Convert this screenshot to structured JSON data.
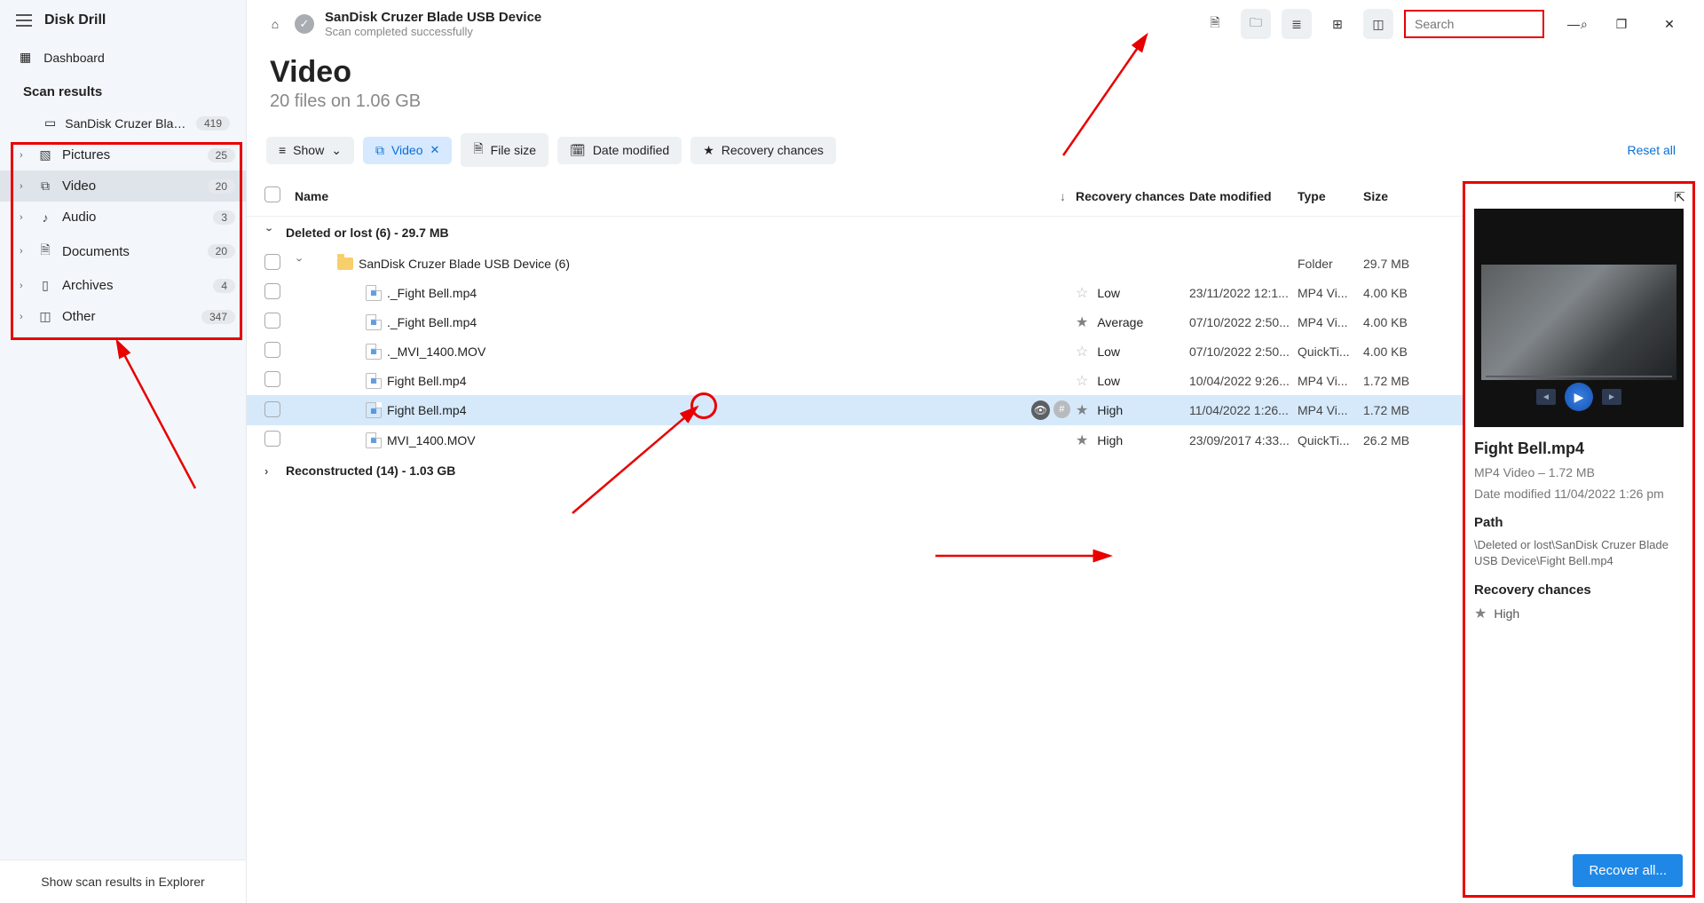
{
  "app": {
    "title": "Disk Drill"
  },
  "sidebar": {
    "dashboard": "Dashboard",
    "section": "Scan results",
    "device": {
      "label": "SanDisk Cruzer Blade US...",
      "count": "419"
    },
    "categories": [
      {
        "label": "Pictures",
        "count": "25"
      },
      {
        "label": "Video",
        "count": "20"
      },
      {
        "label": "Audio",
        "count": "3"
      },
      {
        "label": "Documents",
        "count": "20"
      },
      {
        "label": "Archives",
        "count": "4"
      },
      {
        "label": "Other",
        "count": "347"
      }
    ],
    "footer": "Show scan results in Explorer"
  },
  "header": {
    "device_title": "SanDisk Cruzer Blade USB Device",
    "status": "Scan completed successfully",
    "search_placeholder": "Search"
  },
  "heading": {
    "title": "Video",
    "subtitle": "20 files on 1.06 GB"
  },
  "chips": {
    "show": "Show",
    "video": "Video",
    "filesize": "File size",
    "datemod": "Date modified",
    "recchances": "Recovery chances",
    "reset": "Reset all"
  },
  "columns": {
    "name": "Name",
    "rec": "Recovery chances",
    "date": "Date modified",
    "type": "Type",
    "size": "Size"
  },
  "groups": {
    "g1": "Deleted or lost (6) - 29.7 MB",
    "g2": "Reconstructed (14) - 1.03 GB"
  },
  "folder_row": {
    "name": "SanDisk Cruzer Blade USB Device (6)",
    "type": "Folder",
    "size": "29.7 MB"
  },
  "files": [
    {
      "name": "._Fight Bell.mp4",
      "rec": "Low",
      "date": "23/11/2022 12:1...",
      "type": "MP4 Vi...",
      "size": "4.00 KB",
      "star": false
    },
    {
      "name": "._Fight Bell.mp4",
      "rec": "Average",
      "date": "07/10/2022 2:50...",
      "type": "MP4 Vi...",
      "size": "4.00 KB",
      "star": true
    },
    {
      "name": "._MVI_1400.MOV",
      "rec": "Low",
      "date": "07/10/2022 2:50...",
      "type": "QuickTi...",
      "size": "4.00 KB",
      "star": false
    },
    {
      "name": "Fight Bell.mp4",
      "rec": "Low",
      "date": "10/04/2022 9:26...",
      "type": "MP4 Vi...",
      "size": "1.72 MB",
      "star": false
    },
    {
      "name": "Fight Bell.mp4",
      "rec": "High",
      "date": "11/04/2022 1:26...",
      "type": "MP4 Vi...",
      "size": "1.72 MB",
      "star": true
    },
    {
      "name": "MVI_1400.MOV",
      "rec": "High",
      "date": "23/09/2017 4:33...",
      "type": "QuickTi...",
      "size": "26.2 MB",
      "star": true
    }
  ],
  "preview": {
    "title": "Fight Bell.mp4",
    "meta": "MP4 Video – 1.72 MB",
    "modified": "Date modified 11/04/2022 1:26 pm",
    "path_label": "Path",
    "path": "\\Deleted or lost\\SanDisk Cruzer Blade USB Device\\Fight Bell.mp4",
    "rec_label": "Recovery chances",
    "rec_value": "High"
  },
  "footer": {
    "recover": "Recover all..."
  }
}
